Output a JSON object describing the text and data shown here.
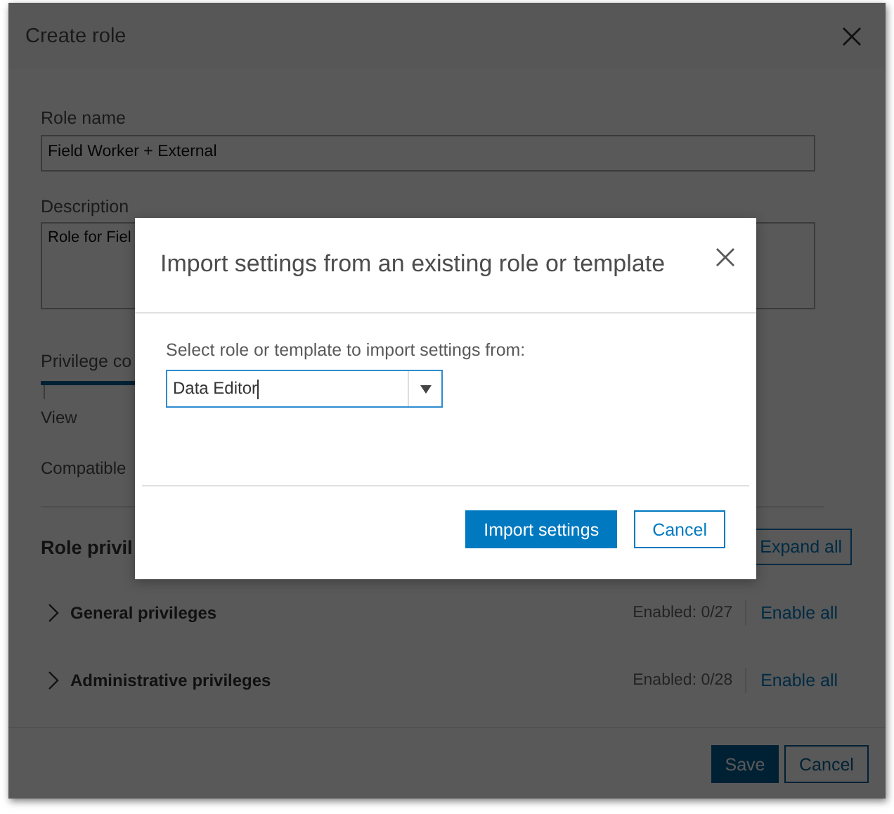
{
  "window": {
    "title": "Create role"
  },
  "form": {
    "role_name": {
      "label": "Role name",
      "value": "Field Worker + External"
    },
    "description": {
      "label": "Description",
      "value": "Role for Fiel"
    },
    "privilege_label": "Privilege co",
    "view_label": "View",
    "compatible_label": "Compatible"
  },
  "role_privileges": {
    "title": "Role privil",
    "expand_button": "Expand all",
    "groups": [
      {
        "name": "General privileges",
        "expanded": false,
        "enabled": "Enabled: 0/27",
        "action": "Enable all"
      },
      {
        "name": "Administrative privileges",
        "expanded": false,
        "enabled": "Enabled: 0/28",
        "action": "Enable all"
      }
    ]
  },
  "footer": {
    "buttons": [
      {
        "label": "Save",
        "kind": "primary"
      },
      {
        "label": "Cancel",
        "kind": "secondary"
      }
    ]
  },
  "import_dialog": {
    "title": "Import settings from an existing role or template",
    "field_label": "Select role or template to import settings from:",
    "select": {
      "value": "Data Editor"
    },
    "buttons": [
      {
        "label": "Import settings",
        "kind": "primary"
      },
      {
        "label": "Cancel",
        "kind": "secondary"
      }
    ]
  }
}
